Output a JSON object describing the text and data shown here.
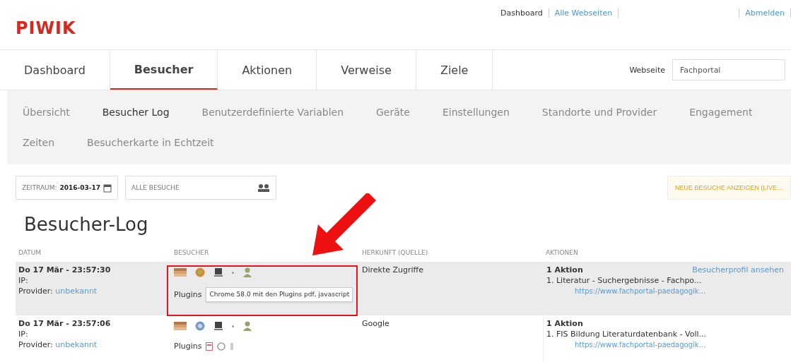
{
  "header": {
    "logo": "PIWIK",
    "top_links": [
      {
        "label": "Dashboard",
        "kind": "current"
      },
      {
        "label": "Alle Webseiten",
        "kind": "link"
      },
      {
        "label": "Abmelden",
        "kind": "link"
      }
    ]
  },
  "tabs": [
    {
      "label": "Dashboard",
      "selected": false
    },
    {
      "label": "Besucher",
      "selected": true
    },
    {
      "label": "Aktionen",
      "selected": false
    },
    {
      "label": "Verweise",
      "selected": false
    },
    {
      "label": "Ziele",
      "selected": false
    }
  ],
  "site_selector": {
    "label": "Webseite",
    "value": "Fachportal"
  },
  "subnav": [
    {
      "label": "Übersicht",
      "selected": false
    },
    {
      "label": "Besucher Log",
      "selected": true
    },
    {
      "label": "Benutzerdefinierte Variablen",
      "selected": false
    },
    {
      "label": "Geräte",
      "selected": false
    },
    {
      "label": "Einstellungen",
      "selected": false
    },
    {
      "label": "Standorte und Provider",
      "selected": false
    },
    {
      "label": "Engagement",
      "selected": false
    },
    {
      "label": "Zeiten",
      "selected": false
    },
    {
      "label": "Besucherkarte in Echtzeit",
      "selected": false
    }
  ],
  "filters": {
    "period_label": "ZEITRAUM:",
    "period_value": "2016-03-17",
    "segment": "ALLE BESUCHE",
    "live_button": "NEUE BESUCHE ANZEIGEN (LIVE…"
  },
  "title": "Besucher-Log",
  "table": {
    "columns": [
      "DATUM",
      "BESUCHER",
      "HERKUNFT (QUELLE)",
      "AKTIONEN"
    ],
    "rows": [
      {
        "date": "Do 17 Mär - 23:57:30",
        "ip_label": "IP:",
        "provider_label": "Provider:",
        "provider": "unbekannt",
        "plugins_label": "Plugins",
        "tooltip": "Chrome 58.0 mit den Plugins pdf, javascript",
        "highlighted": true,
        "source": "Direkte Zugriffe",
        "actions_count": "1 Aktion",
        "profile_link": "Besucherprofil ansehen",
        "action": "1. Literatur - Suchergebnisse - Fachpo...",
        "action_url": "https://www.fachportal-paedagogik..."
      },
      {
        "date": "Do 17 Mär - 23:57:06",
        "ip_label": "IP:",
        "provider_label": "Provider:",
        "provider": "unbekannt",
        "plugins_label": "Plugins",
        "plugins": [
          {
            "kind": "pdf"
          },
          {
            "kind": "flash"
          },
          {
            "kind": "java"
          }
        ],
        "highlighted": false,
        "source": "Google",
        "actions_count": "1 Aktion",
        "action": "1. FIS Bildung Literaturdatenbank - Voll...",
        "action_url": "https://www.fachportal-paedagogik..."
      }
    ]
  }
}
